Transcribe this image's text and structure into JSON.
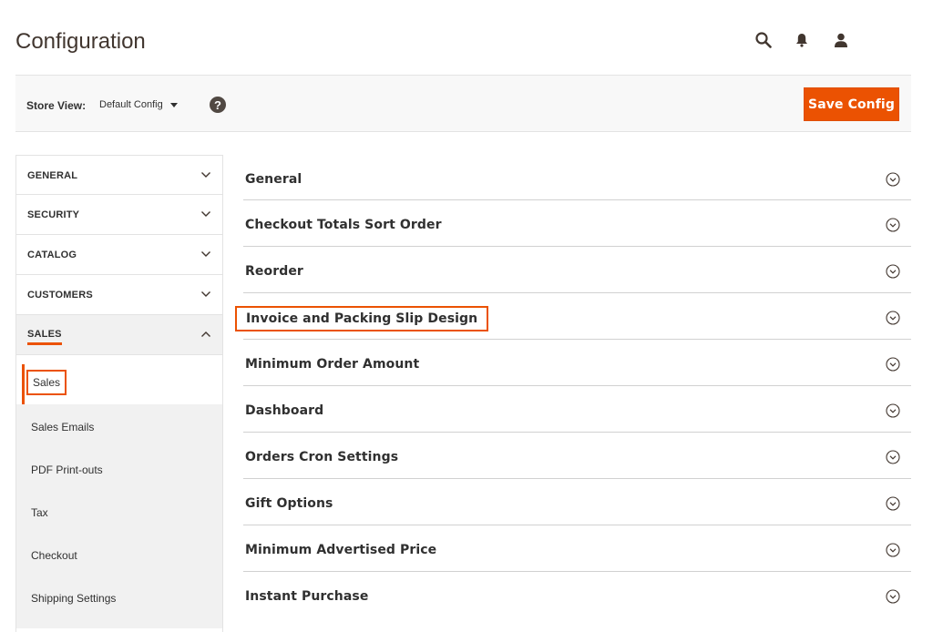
{
  "header": {
    "title": "Configuration",
    "icons": [
      "search-icon",
      "bell-icon",
      "user-icon"
    ]
  },
  "store_bar": {
    "label": "Store View:",
    "selected": "Default Config",
    "help": "?",
    "save_label": "Save Config"
  },
  "sidebar": {
    "sections": [
      {
        "label": "GENERAL"
      },
      {
        "label": "SECURITY"
      },
      {
        "label": "CATALOG"
      },
      {
        "label": "CUSTOMERS"
      },
      {
        "label": "SALES"
      }
    ],
    "sales_items": [
      {
        "label": "Sales"
      },
      {
        "label": "Sales Emails"
      },
      {
        "label": "PDF Print-outs"
      },
      {
        "label": "Tax"
      },
      {
        "label": "Checkout"
      },
      {
        "label": "Shipping Settings"
      }
    ]
  },
  "groups": [
    {
      "title": "General"
    },
    {
      "title": "Checkout Totals Sort Order"
    },
    {
      "title": "Reorder"
    },
    {
      "title": "Invoice and Packing Slip Design"
    },
    {
      "title": "Minimum Order Amount"
    },
    {
      "title": "Dashboard"
    },
    {
      "title": "Orders Cron Settings"
    },
    {
      "title": "Gift Options"
    },
    {
      "title": "Minimum Advertised Price"
    },
    {
      "title": "Instant Purchase"
    }
  ],
  "colors": {
    "accent": "#eb5202",
    "text": "#303030",
    "border": "#e3e3e3"
  }
}
